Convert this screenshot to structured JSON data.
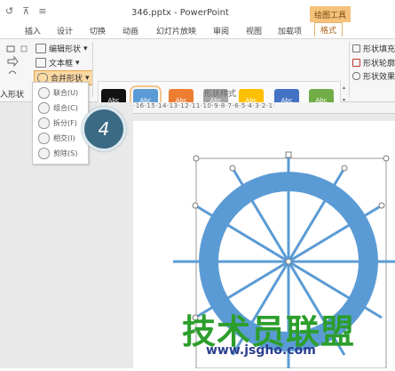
{
  "title_bar": {
    "document_title": "346.pptx - PowerPoint",
    "contextual_group": "绘图工具",
    "quick_access": [
      "↺",
      "⊼",
      "≡"
    ]
  },
  "tabs": [
    "插入",
    "设计",
    "切换",
    "动画",
    "幻灯片放映",
    "审阅",
    "视图",
    "加载项",
    "格式"
  ],
  "ribbon": {
    "edit_shape": "编辑形状",
    "text_box": "文本框",
    "merge_shapes": "合并形状",
    "insert_shape_group": "入形状",
    "shape_style_group": "形状样式",
    "shape_fill": "形状填充",
    "shape_outline": "形状轮廓",
    "shape_effects": "形状效果",
    "style_swatches": [
      {
        "label": "Abc",
        "color": "#111111"
      },
      {
        "label": "Abc",
        "color": "#5b9bd5"
      },
      {
        "label": "Abc",
        "color": "#ed7d31"
      },
      {
        "label": "Abc",
        "color": "#a5a5a5"
      },
      {
        "label": "Abc",
        "color": "#ffc000"
      },
      {
        "label": "Abc",
        "color": "#4472c4"
      },
      {
        "label": "Abc",
        "color": "#70ad47"
      }
    ]
  },
  "merge_menu": {
    "items": [
      "联合(U)",
      "组合(C)",
      "拆分(F)",
      "相交(I)",
      "剪除(S)"
    ]
  },
  "step_badge": "4",
  "ruler": "·16·15·14·13·12·11·10·9·8·7·6·5·4·3·2·1·",
  "watermark": {
    "text": "技术员联盟",
    "url": "www.jsgho.com"
  },
  "colors": {
    "wheel_blue": "#5b9bd5",
    "contextual_tab": "#f4c27a",
    "watermark_green": "#2c9e2c"
  }
}
